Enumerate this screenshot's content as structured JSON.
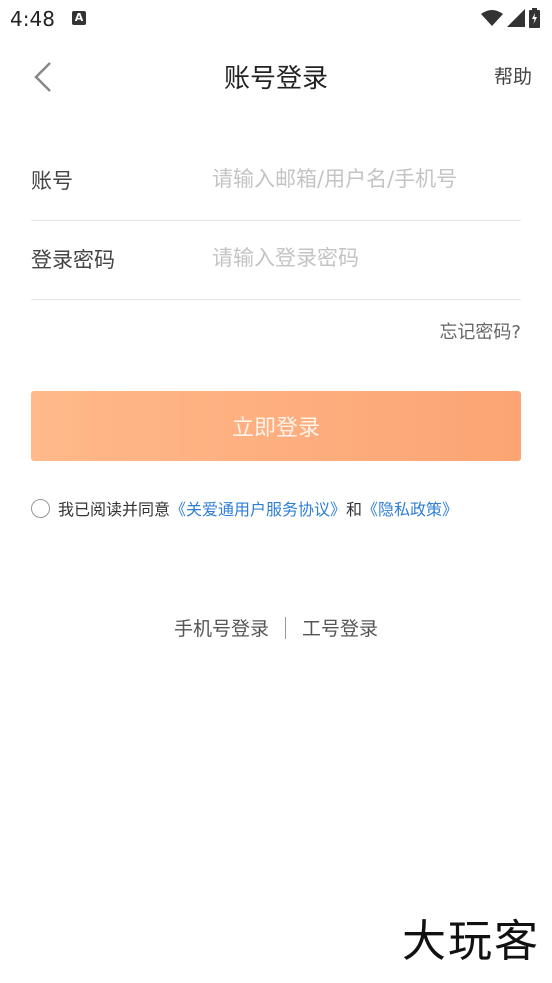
{
  "status_bar": {
    "time": "4:48",
    "notification_icon": "A"
  },
  "nav": {
    "title": "账号登录",
    "help_label": "帮助"
  },
  "form": {
    "account_label": "账号",
    "account_placeholder": "请输入邮箱/用户名/手机号",
    "password_label": "登录密码",
    "password_placeholder": "请输入登录密码",
    "forgot_label": "忘记密码?"
  },
  "login_button_label": "立即登录",
  "agreement": {
    "prefix": "我已阅读并同意",
    "user_agreement": "《关爱通用户服务协议》",
    "and": "和",
    "privacy_policy": "《隐私政策》"
  },
  "alt_login": {
    "phone_login": "手机号登录",
    "employee_login": "工号登录"
  },
  "watermark": "大玩客",
  "colors": {
    "accent_start": "#ffb98a",
    "accent_end": "#fca474",
    "link": "#2f7fd6"
  }
}
